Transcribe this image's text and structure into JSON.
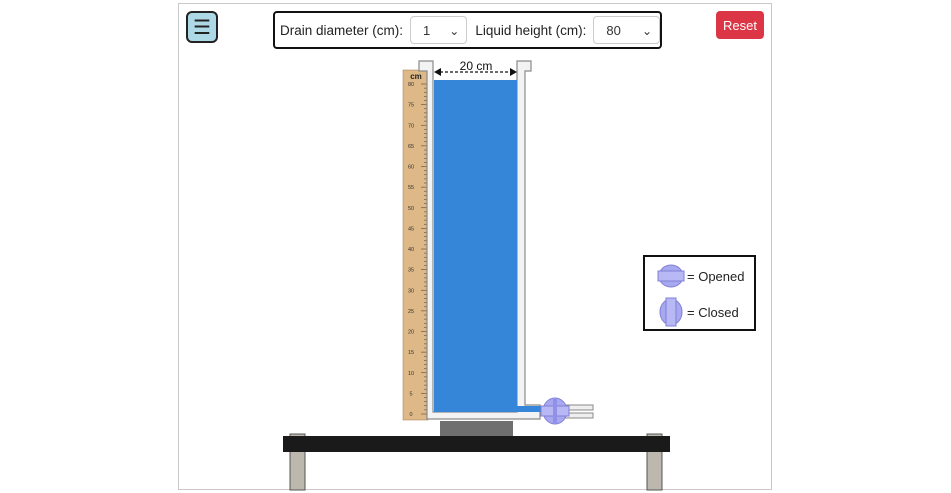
{
  "toolbar": {
    "menu_icon": "hamburger-icon",
    "drain_label": "Drain diameter (cm):",
    "drain_value": "1",
    "height_label": "Liquid height (cm):",
    "height_value": "80",
    "reset_label": "Reset"
  },
  "tank": {
    "width_label": "20 cm",
    "liquid_height_cm": 80,
    "liquid_color": "#3585d9"
  },
  "ruler": {
    "unit": "cm",
    "ticks": [
      "0",
      "5",
      "10",
      "15",
      "20",
      "25",
      "30",
      "35",
      "40",
      "45",
      "50",
      "55",
      "60",
      "65",
      "70",
      "75",
      "80"
    ],
    "max": 80
  },
  "valve": {
    "state": "opened",
    "color": "#a8a8f0"
  },
  "legend": {
    "opened_label": "= Opened",
    "closed_label": "= Closed",
    "opened_icon": "valve-open-icon",
    "closed_icon": "valve-closed-icon"
  },
  "colors": {
    "accent": "#add8e6",
    "reset": "#dc3545",
    "ruler": "#deb887"
  }
}
